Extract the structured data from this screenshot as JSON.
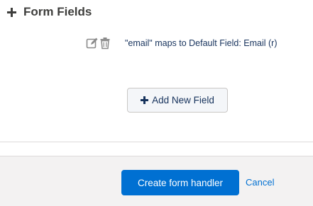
{
  "section": {
    "title": "Form Fields",
    "icon": "plus-icon"
  },
  "field": {
    "edit_icon": "edit-icon",
    "delete_icon": "trash-icon",
    "mapping_text": "\"email\" maps to Default Field: Email (r)"
  },
  "add_field_button": {
    "label": "Add New Field",
    "icon": "plus-icon"
  },
  "footer": {
    "submit_label": "Create form handler",
    "cancel_label": "Cancel"
  },
  "colors": {
    "primary": "#0070d2",
    "text": "#16325c",
    "header_text": "#3e3e3c",
    "icon_gray": "#8a8a8a",
    "footer_bg": "#f3f2f2",
    "neutral_button_bg": "#f4f6f9",
    "border": "#c9c7c5"
  }
}
